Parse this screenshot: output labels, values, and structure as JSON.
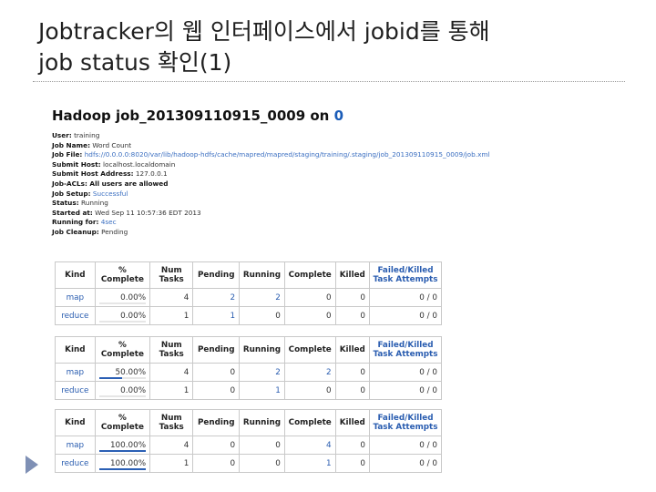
{
  "slide": {
    "title_line1": "Jobtracker의 웹 인터페이스에서 jobid를 통해",
    "title_line2": "job status 확인(1)"
  },
  "screenshot": {
    "heading_prefix": "Hadoop job_201309110915_0009 on ",
    "heading_link": "0",
    "info": [
      {
        "label": "User:",
        "value": "training",
        "link": false
      },
      {
        "label": "Job Name:",
        "value": "Word Count",
        "link": false
      },
      {
        "label": "Job File:",
        "value": "hdfs://0.0.0.0:8020/var/lib/hadoop-hdfs/cache/mapred/mapred/staging/training/.staging/job_201309110915_0009/job.xml",
        "link": true
      },
      {
        "label": "Submit Host:",
        "value": "localhost.localdomain",
        "link": false
      },
      {
        "label": "Submit Host Address:",
        "value": "127.0.0.1",
        "link": false
      },
      {
        "label": "Job-ACLs: All users are allowed",
        "value": "",
        "link": false
      },
      {
        "label": "Job Setup:",
        "value": "Successful",
        "link": true
      },
      {
        "label": "Status:",
        "value": "Running",
        "link": false
      },
      {
        "label": "Started at:",
        "value": "Wed Sep 11 10:57:36 EDT 2013",
        "link": false
      },
      {
        "label": "Running for:",
        "value": "4sec",
        "link": true
      },
      {
        "label": "Job Cleanup:",
        "value": "Pending",
        "link": false
      }
    ],
    "columns": [
      "Kind",
      "% Complete",
      "Num Tasks",
      "Pending",
      "Running",
      "Complete",
      "Killed",
      "Failed/Killed Task Attempts"
    ],
    "tables": [
      {
        "rows": [
          {
            "kind": "map",
            "pct": "0.00%",
            "fill": 0.0,
            "num": "4",
            "pending": "2",
            "running": "2",
            "complete": "0",
            "killed": "0",
            "failed": "0 / 0",
            "link_cols": [
              "pending",
              "running"
            ]
          },
          {
            "kind": "reduce",
            "pct": "0.00%",
            "fill": 0.0,
            "num": "1",
            "pending": "1",
            "running": "0",
            "complete": "0",
            "killed": "0",
            "failed": "0 / 0",
            "link_cols": [
              "pending"
            ]
          }
        ]
      },
      {
        "rows": [
          {
            "kind": "map",
            "pct": "50.00%",
            "fill": 0.5,
            "num": "4",
            "pending": "0",
            "running": "2",
            "complete": "2",
            "killed": "0",
            "failed": "0 / 0",
            "link_cols": [
              "running",
              "complete"
            ]
          },
          {
            "kind": "reduce",
            "pct": "0.00%",
            "fill": 0.0,
            "num": "1",
            "pending": "0",
            "running": "1",
            "complete": "0",
            "killed": "0",
            "failed": "0 / 0",
            "link_cols": [
              "running"
            ]
          }
        ]
      },
      {
        "rows": [
          {
            "kind": "map",
            "pct": "100.00%",
            "fill": 1.0,
            "num": "4",
            "pending": "0",
            "running": "0",
            "complete": "4",
            "killed": "0",
            "failed": "0 / 0",
            "link_cols": [
              "complete"
            ]
          },
          {
            "kind": "reduce",
            "pct": "100.00%",
            "fill": 1.0,
            "num": "1",
            "pending": "0",
            "running": "0",
            "complete": "1",
            "killed": "0",
            "failed": "0 / 0",
            "link_cols": [
              "complete"
            ]
          }
        ]
      }
    ]
  },
  "colors": {
    "link": "#2a5db0",
    "bar": "#2b5fb4",
    "bullet": "#7f90b5"
  }
}
